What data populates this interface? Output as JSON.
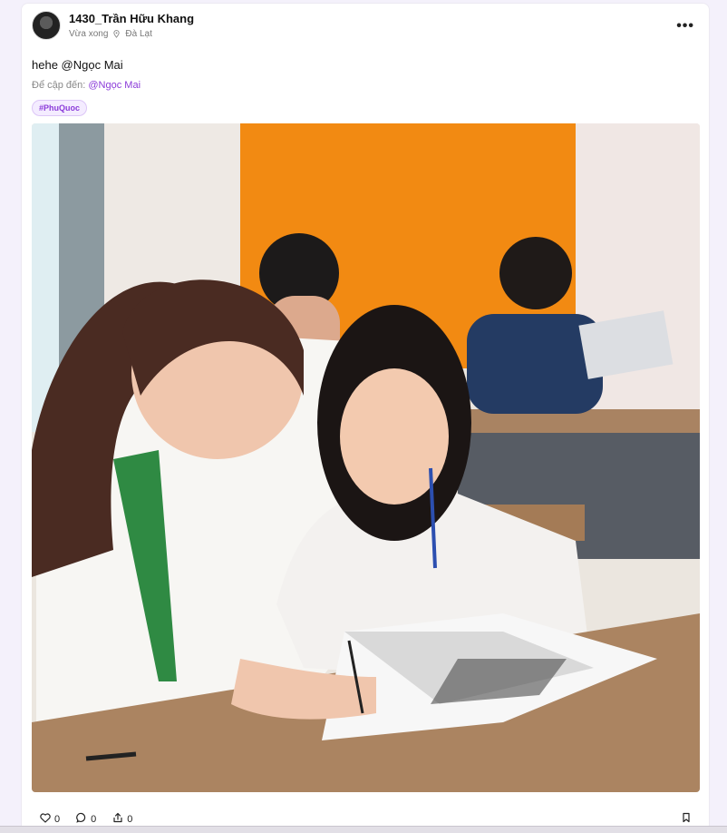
{
  "post": {
    "author": "1430_Trần Hữu Khang",
    "time": "Vừa xong",
    "location": "Đà Lạt",
    "text": "hehe @Ngọc Mai",
    "mention_label": "Để cập đến:",
    "mention_name": "@Ngọc Mai",
    "tag": "#PhuQuoc",
    "more_label": "•••"
  },
  "actions": {
    "likes": "0",
    "comments": "0",
    "shares": "0"
  },
  "icons": [
    "pin-icon",
    "heart-icon",
    "comment-icon",
    "share-icon",
    "bookmark-icon"
  ],
  "colors": {
    "accent": "#8b3bd9",
    "tag_bg": "#f4ecff"
  }
}
